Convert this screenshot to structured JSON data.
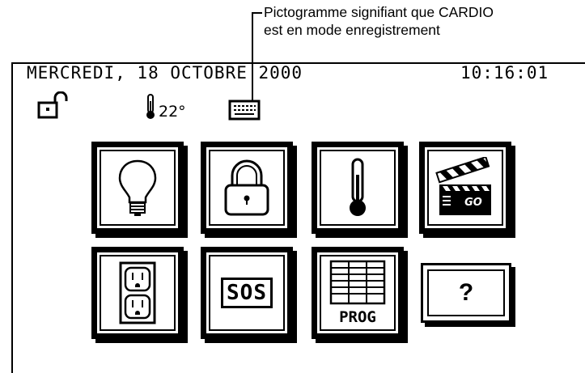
{
  "annotation": {
    "line1": "Pictogramme signifiant que CARDIO",
    "line2": "est en mode enregistrement"
  },
  "status_bar": {
    "date": "MERCREDI, 18 OCTOBRE 2000",
    "time": "10:16:01",
    "temperature": "22°",
    "lock_state": "unlocked-padlock-icon",
    "recording_indicator": "keyboard-icon"
  },
  "tiles": [
    {
      "name": "lighting",
      "icon": "light-bulb-icon"
    },
    {
      "name": "security",
      "icon": "padlock-icon"
    },
    {
      "name": "heating",
      "icon": "thermometer-icon"
    },
    {
      "name": "scenarios",
      "icon": "clapperboard-icon",
      "clapper_label": "GO"
    },
    {
      "name": "outlets",
      "icon": "power-outlet-icon"
    },
    {
      "name": "alarm",
      "label": "SOS"
    },
    {
      "name": "programming",
      "label": "PROG",
      "icon": "schedule-grid-icon"
    },
    {
      "name": "help",
      "label": "?"
    }
  ]
}
